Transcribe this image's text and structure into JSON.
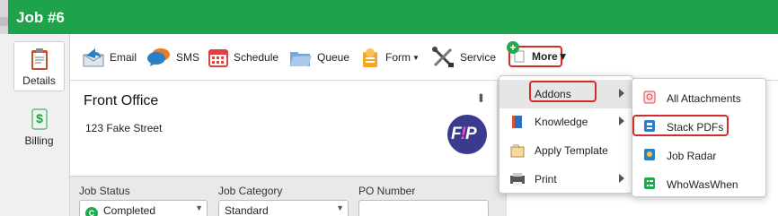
{
  "window": {
    "title": "Job #6"
  },
  "nav": [
    {
      "label": "Details",
      "icon": "clipboard-icon",
      "active": true
    },
    {
      "label": "Billing",
      "icon": "dollar-document-icon",
      "active": false
    }
  ],
  "toolbar": {
    "email": "Email",
    "sms": "SMS",
    "schedule": "Schedule",
    "queue": "Queue",
    "form": "Form",
    "service": "Service",
    "more": "More"
  },
  "job": {
    "office": "Front Office",
    "address": "123 Fake Street",
    "logo_text_a": "F",
    "logo_text_b": "!",
    "logo_text_c": "P"
  },
  "fields": {
    "status_label": "Job Status",
    "status_value": "Completed",
    "status_icon_letter": "C",
    "category_label": "Job Category",
    "category_value": "Standard",
    "po_label": "PO Number",
    "po_value": ""
  },
  "more_menu": [
    {
      "label": "Addons",
      "icon": "",
      "has_submenu": true,
      "highlighted": true
    },
    {
      "label": "Knowledge",
      "icon": "book-icon",
      "has_submenu": true,
      "highlighted": false
    },
    {
      "label": "Apply Template",
      "icon": "template-icon",
      "has_submenu": false,
      "highlighted": false
    },
    {
      "label": "Print",
      "icon": "printer-icon",
      "has_submenu": true,
      "highlighted": false
    }
  ],
  "addons_menu": [
    {
      "label": "All Attachments",
      "icon": "attachments-icon"
    },
    {
      "label": "Stack PDFs",
      "icon": "stack-pdf-icon"
    },
    {
      "label": "Job Radar",
      "icon": "radar-icon"
    },
    {
      "label": "WhoWasWhen",
      "icon": "whowaswhen-icon"
    }
  ],
  "colors": {
    "brand_green": "#1fa34a",
    "highlight_red": "#d42b2b"
  }
}
